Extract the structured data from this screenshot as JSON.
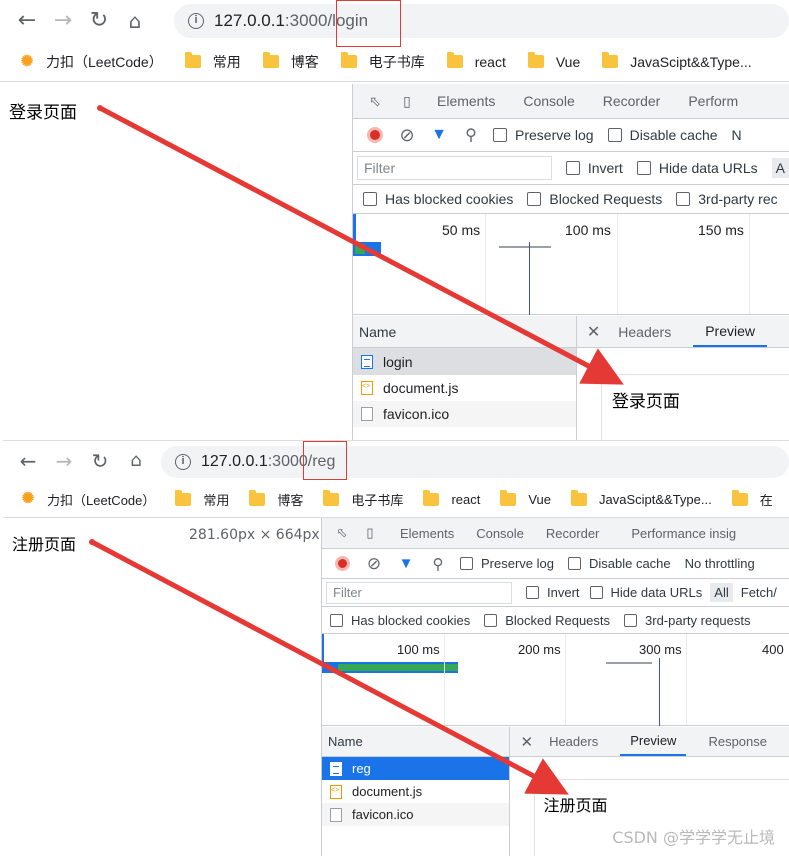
{
  "screens": [
    {
      "address": {
        "host": "127.0.0.1",
        "port": ":3000",
        "path": "/login"
      },
      "bookmarks": [
        {
          "label": "力扣（LeetCode）",
          "icon": "leetcode-icon"
        },
        {
          "label": "常用",
          "icon": "folder-icon"
        },
        {
          "label": "博客",
          "icon": "folder-icon"
        },
        {
          "label": "电子书库",
          "icon": "folder-icon"
        },
        {
          "label": "react",
          "icon": "folder-icon"
        },
        {
          "label": "Vue",
          "icon": "folder-icon"
        },
        {
          "label": "JavaScipt&&Type...",
          "icon": "folder-icon"
        }
      ],
      "page_text": "登录页面",
      "devtools": {
        "tabs": [
          "Elements",
          "Console",
          "Recorder",
          "Perform"
        ],
        "preserve_log": "Preserve log",
        "disable_cache": "Disable cache",
        "throttling": "N",
        "filter_placeholder": "Filter",
        "invert": "Invert",
        "hide_data_urls": "Hide data URLs",
        "all": "A",
        "has_blocked_cookies": "Has blocked cookies",
        "blocked_requests": "Blocked Requests",
        "third_party": "3rd-party rec",
        "ticks": [
          "50 ms",
          "100 ms",
          "150 ms"
        ],
        "name_header": "Name",
        "requests": [
          {
            "name": "login",
            "type": "doc"
          },
          {
            "name": "document.js",
            "type": "js"
          },
          {
            "name": "favicon.ico",
            "type": "other"
          }
        ],
        "detail_tabs": [
          "Headers",
          "Preview"
        ],
        "active_detail_tab": "Preview",
        "preview_text": "登录页面"
      }
    },
    {
      "address": {
        "host": "127.0.0.1",
        "port": ":3000",
        "path": "/reg"
      },
      "bookmarks": [
        {
          "label": "力扣（LeetCode）",
          "icon": "leetcode-icon"
        },
        {
          "label": "常用",
          "icon": "folder-icon"
        },
        {
          "label": "博客",
          "icon": "folder-icon"
        },
        {
          "label": "电子书库",
          "icon": "folder-icon"
        },
        {
          "label": "react",
          "icon": "folder-icon"
        },
        {
          "label": "Vue",
          "icon": "folder-icon"
        },
        {
          "label": "JavaScipt&&Type...",
          "icon": "folder-icon"
        },
        {
          "label": "在",
          "icon": "folder-icon"
        }
      ],
      "page_text": "注册页面",
      "viewport_size": "281.60px × 664px",
      "devtools": {
        "tabs": [
          "Elements",
          "Console",
          "Recorder",
          "Performance insig"
        ],
        "preserve_log": "Preserve log",
        "disable_cache": "Disable cache",
        "throttling": "No throttling",
        "filter_placeholder": "Filter",
        "invert": "Invert",
        "hide_data_urls": "Hide data URLs",
        "all": "All",
        "fetch": "Fetch/",
        "has_blocked_cookies": "Has blocked cookies",
        "blocked_requests": "Blocked Requests",
        "third_party": "3rd-party requests",
        "ticks": [
          "100 ms",
          "200 ms",
          "300 ms",
          "400"
        ],
        "name_header": "Name",
        "requests": [
          {
            "name": "reg",
            "type": "doc"
          },
          {
            "name": "document.js",
            "type": "js"
          },
          {
            "name": "favicon.ico",
            "type": "other"
          }
        ],
        "detail_tabs": [
          "Headers",
          "Preview",
          "Response"
        ],
        "active_detail_tab": "Preview",
        "preview_text": "注册页面"
      }
    }
  ],
  "watermark": "CSDN @学学学无止境",
  "colors": {
    "annotation": "#e53935",
    "accent": "#1a73e8",
    "record": "#d93025",
    "folder": "#f9c33d"
  }
}
